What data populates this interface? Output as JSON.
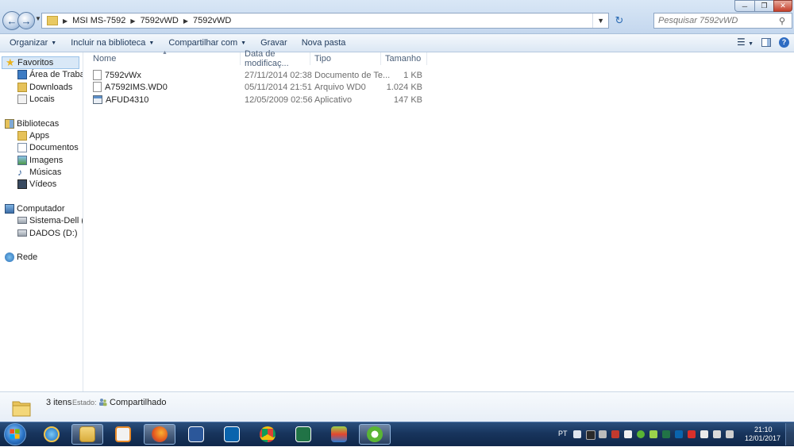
{
  "address": {
    "breadcrumbs": [
      "MSI MS-7592",
      "7592vWD",
      "7592vWD"
    ],
    "search_placeholder": "Pesquisar 7592vWD"
  },
  "toolbar": {
    "organize": "Organizar",
    "include_library": "Incluir na biblioteca",
    "share_with": "Compartilhar com",
    "burn": "Gravar",
    "new_folder": "Nova pasta"
  },
  "nav": {
    "favorites": "Favoritos",
    "desktop": "Área de Trabalho",
    "downloads": "Downloads",
    "places": "Locais",
    "libraries": "Bibliotecas",
    "apps": "Apps",
    "documents": "Documentos",
    "images": "Imagens",
    "music": "Músicas",
    "videos": "Vídeos",
    "computer": "Computador",
    "drive_c": "Sistema-Dell (C:)",
    "drive_d": "DADOS (D:)",
    "network": "Rede"
  },
  "columns": {
    "name": "Nome",
    "date": "Data de modificaç...",
    "type": "Tipo",
    "size": "Tamanho"
  },
  "files": [
    {
      "name": "7592vWx",
      "date": "27/11/2014 02:38",
      "type": "Documento de Te...",
      "size": "1 KB",
      "icon": "text-file-icon"
    },
    {
      "name": "A7592IMS.WD0",
      "date": "05/11/2014 21:51",
      "type": "Arquivo WD0",
      "size": "1.024 KB",
      "icon": "file-icon"
    },
    {
      "name": "AFUD4310",
      "date": "12/05/2009 02:56",
      "type": "Aplicativo",
      "size": "147 KB",
      "icon": "application-icon"
    }
  ],
  "details": {
    "item_count": "3 itens",
    "state_label": "Estado:",
    "state_value": "Compartilhado"
  },
  "taskbar": {
    "language": "PT",
    "time": "21:10",
    "date": "12/01/2017"
  },
  "colors": {
    "selection": "#d9e8f7",
    "taskbar": "#18355d"
  }
}
